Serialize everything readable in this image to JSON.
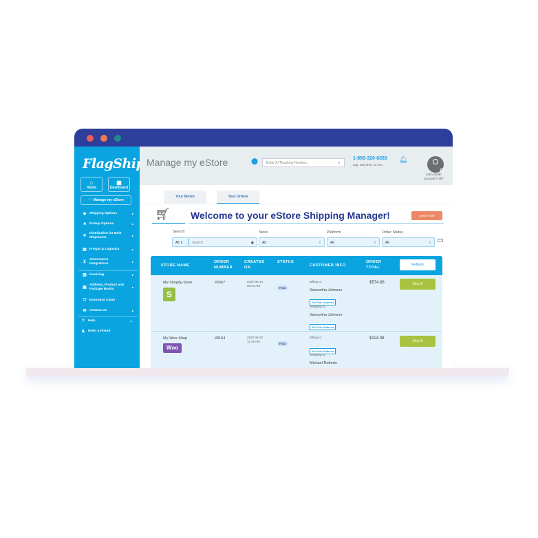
{
  "window": {
    "colors": {
      "close": "#ee5b5b",
      "minimize": "#f07b52",
      "maximize": "#1f8a8a"
    }
  },
  "sidebar": {
    "logo": "FlagShip",
    "home": "Home",
    "dashboard": "Dashboard",
    "manage": "Manage my eStore",
    "items": [
      {
        "label": "Shipping Options",
        "icon": "box-icon"
      },
      {
        "label": "Pickup Options",
        "icon": "truck-icon"
      },
      {
        "label": "Distribution for Bulk Shipments",
        "icon": "distribution-icon"
      },
      {
        "label": "Freight & Logistics",
        "icon": "freight-icon"
      },
      {
        "label": "eCommerce Integrations",
        "icon": "cart-icon"
      },
      {
        "label": "Invoicing",
        "icon": "invoice-icon"
      },
      {
        "label": "Address, Product and Package Books",
        "icon": "book-icon"
      },
      {
        "label": "Insurance Claim",
        "icon": "shield-icon"
      },
      {
        "label": "Contact Us",
        "icon": "mail-icon"
      },
      {
        "label": "Help",
        "icon": "help-icon"
      },
      {
        "label": "Refer a Friend",
        "icon": "refer-icon"
      }
    ]
  },
  "header": {
    "title": "Manage my eStore",
    "tracking_placeholder": "Enter A [T]racking Number...",
    "phone": "1-866-320-8383",
    "wait": "avg. wait time: 11 sec.",
    "user": "John Smith",
    "account": "Account # 197"
  },
  "tabs": [
    "Your Stores",
    "Your Orders"
  ],
  "welcome": {
    "title": "Welcome to your eStore Shipping Manager!",
    "learn_more": "Learn more"
  },
  "filters": {
    "search_label": "Search",
    "search_scope": "All",
    "search_placeholder": "Search",
    "store_label": "Store",
    "store_value": "All",
    "platform_label": "Platform",
    "platform_value": "All",
    "status_label": "Order Status",
    "status_value": "All"
  },
  "table": {
    "headers": [
      "STORE NAME",
      "ORDER NUMBER",
      "CREATED ON",
      "STATUS",
      "CUSTOMER INFO",
      "ORDER TOTAL"
    ],
    "refresh": "Refresh",
    "billing_label": "Billing to:",
    "shipping_label": "Shipping to:",
    "see_full": "See Full Address",
    "ship_label": "Ship it!",
    "rows": [
      {
        "store": "My-Shopify-Store",
        "platform": "Shopify",
        "order": "#2667",
        "date": "2022-06-14",
        "time": "09:34 AM",
        "status": "Paid",
        "billing": "Samantha Johnson",
        "shipping": "Samantha Johnson",
        "total": "$574.88"
      },
      {
        "store": "My-Woo-Shop",
        "platform": "WooCommerce",
        "logo": "Woo",
        "order": "#8154",
        "date": "2022-06-02",
        "time": "11:39 AM",
        "status": "Paid",
        "shipping": "Michael Roberts",
        "total": "$114.98"
      }
    ]
  }
}
